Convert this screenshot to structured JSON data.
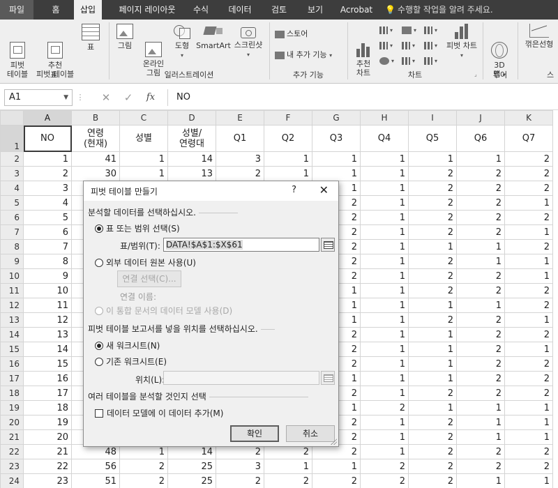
{
  "tabs": [
    "파일",
    "홈",
    "삽입",
    "페이지 레이아웃",
    "수식",
    "데이터",
    "검토",
    "보기",
    "Acrobat"
  ],
  "tell_me": "수행할 작업을 알려 주세요.",
  "ribbon": {
    "pivot": "피벗\n테이블",
    "rec_pivot": "추천\n피벗 테이블",
    "table": "표",
    "tables_group": "표",
    "picture": "그림",
    "online_picture": "온라인\n그림",
    "shapes": "도형",
    "smartart": "SmartArt",
    "screenshot": "스크린샷",
    "illust_group": "일러스트레이션",
    "store": "스토어",
    "my_addins": "내 추가 기능",
    "addins_group": "추가 기능",
    "rec_charts": "추천\n차트",
    "pivot_chart": "피벗 차트",
    "charts_group": "차트",
    "map3d": "3D\n맵",
    "tours_group": "투어",
    "line_spark": "꺾은선형",
    "spark_group_partial": "스"
  },
  "formula_bar": {
    "name_box": "A1",
    "formula": "NO"
  },
  "columns": [
    "A",
    "B",
    "C",
    "D",
    "E",
    "F",
    "G",
    "H",
    "I",
    "J",
    "K"
  ],
  "header_row": [
    "NO",
    "연령\n(현재)",
    "성별",
    "성별/\n연령대",
    "Q1",
    "Q2",
    "Q3",
    "Q4",
    "Q5",
    "Q6",
    "Q7"
  ],
  "rows": [
    [
      "1",
      "41",
      "1",
      "14",
      "3",
      "1",
      "1",
      "1",
      "1",
      "1",
      "2"
    ],
    [
      "2",
      "30",
      "1",
      "13",
      "2",
      "1",
      "1",
      "1",
      "2",
      "2",
      "2"
    ],
    [
      "3",
      "",
      "",
      "",
      "",
      "",
      "1",
      "1",
      "2",
      "2",
      "2"
    ],
    [
      "4",
      "",
      "",
      "",
      "",
      "",
      "2",
      "1",
      "2",
      "2",
      "1"
    ],
    [
      "5",
      "",
      "",
      "",
      "",
      "",
      "2",
      "1",
      "2",
      "2",
      "2"
    ],
    [
      "6",
      "",
      "",
      "",
      "",
      "",
      "2",
      "1",
      "2",
      "2",
      "1"
    ],
    [
      "7",
      "",
      "",
      "",
      "",
      "",
      "2",
      "1",
      "1",
      "1",
      "2"
    ],
    [
      "8",
      "",
      "",
      "",
      "",
      "",
      "2",
      "1",
      "2",
      "1",
      "1"
    ],
    [
      "9",
      "",
      "",
      "",
      "",
      "",
      "2",
      "1",
      "2",
      "2",
      "1"
    ],
    [
      "10",
      "",
      "",
      "",
      "",
      "",
      "1",
      "1",
      "2",
      "2",
      "2"
    ],
    [
      "11",
      "",
      "",
      "",
      "",
      "",
      "1",
      "1",
      "1",
      "1",
      "2"
    ],
    [
      "12",
      "",
      "",
      "",
      "",
      "",
      "1",
      "1",
      "2",
      "2",
      "1"
    ],
    [
      "13",
      "",
      "",
      "",
      "",
      "",
      "2",
      "1",
      "1",
      "2",
      "2"
    ],
    [
      "14",
      "",
      "",
      "",
      "",
      "",
      "2",
      "1",
      "1",
      "2",
      "1"
    ],
    [
      "15",
      "",
      "",
      "",
      "",
      "",
      "2",
      "1",
      "1",
      "2",
      "2"
    ],
    [
      "16",
      "",
      "",
      "",
      "",
      "",
      "1",
      "1",
      "1",
      "2",
      "2"
    ],
    [
      "17",
      "",
      "",
      "",
      "",
      "",
      "2",
      "1",
      "2",
      "2",
      "2"
    ],
    [
      "18",
      "",
      "",
      "",
      "",
      "",
      "1",
      "2",
      "1",
      "1",
      "1"
    ],
    [
      "19",
      "",
      "",
      "",
      "",
      "",
      "2",
      "1",
      "2",
      "1",
      "1"
    ],
    [
      "20",
      "",
      "",
      "",
      "",
      "",
      "2",
      "1",
      "2",
      "1",
      "1"
    ],
    [
      "21",
      "48",
      "1",
      "14",
      "2",
      "2",
      "2",
      "1",
      "2",
      "2",
      "2"
    ],
    [
      "22",
      "56",
      "2",
      "25",
      "3",
      "1",
      "1",
      "2",
      "2",
      "2",
      "2"
    ],
    [
      "23",
      "51",
      "2",
      "25",
      "2",
      "2",
      "2",
      "2",
      "2",
      "1",
      "1"
    ]
  ],
  "dialog": {
    "title": "피벗 테이블 만들기",
    "help": "?",
    "close": "✕",
    "section1": "분석할 데이터를 선택하십시오.",
    "opt_range": "표 또는 범위 선택(S)",
    "range_label": "표/범위(T):",
    "range_value": "DATA!$A$1:$X$61",
    "opt_external": "외부 데이터 원본 사용(U)",
    "choose_conn": "연결 선택(C)...",
    "conn_name": "연결 이름:",
    "opt_datamodel": "이 통합 문서의 데이터 모델 사용(D)",
    "section2": "피벗 테이블 보고서를 넣을 위치를 선택하십시오.",
    "opt_new_sheet": "새 워크시트(N)",
    "opt_existing": "기존 워크시트(E)",
    "location_label": "위치(L):",
    "section3": "여러 테이블을 분석할 것인지 선택",
    "add_to_model": "데이터 모델에 이 데이터 추가(M)",
    "ok": "확인",
    "cancel": "취소"
  }
}
